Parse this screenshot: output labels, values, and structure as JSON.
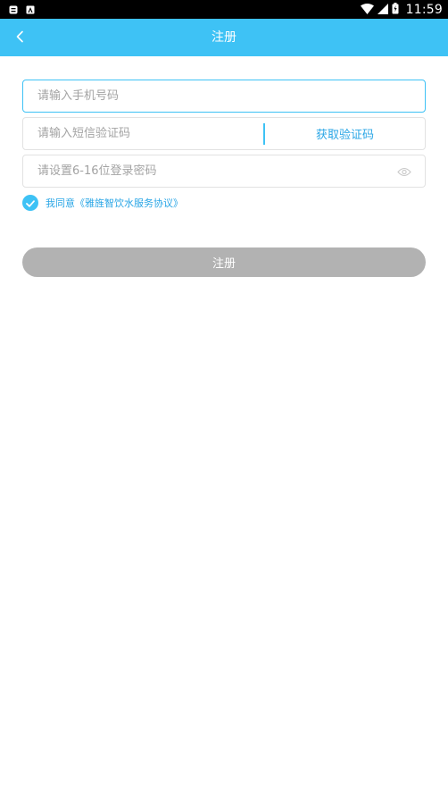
{
  "status_bar": {
    "time": "11:59",
    "icons": [
      "notification-icon",
      "app-notification-icon",
      "wifi-icon",
      "signal-icon",
      "battery-icon"
    ]
  },
  "header": {
    "title": "注册",
    "back_icon": "chevron-left-icon",
    "background": "#3ec2f5"
  },
  "form": {
    "phone_placeholder": "请输入手机号码",
    "code_placeholder": "请输入短信验证码",
    "get_code_label": "获取验证码",
    "password_placeholder": "请设置6-16位登录密码",
    "eye_icon": "eye-icon"
  },
  "agreement": {
    "checked": true,
    "prefix": "我同意",
    "link_text": "《雅旌智饮水服务协议》"
  },
  "submit": {
    "label": "注册",
    "enabled": false,
    "color": "#b2b2b2"
  },
  "colors": {
    "accent": "#3ec2f5",
    "link": "#2aa6e6"
  }
}
